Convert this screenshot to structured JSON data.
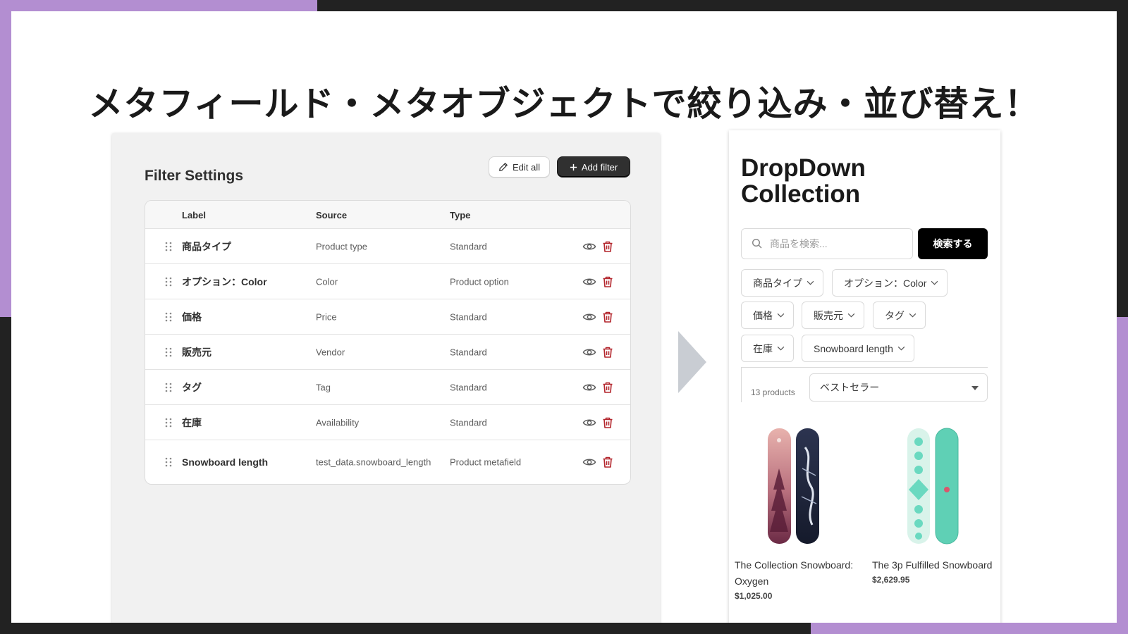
{
  "headline": "メタフィールド・メタオブジェクトで絞り込み・並び替え！",
  "colors": {
    "accent_purple": "#b38ed1",
    "background_dark": "#222222",
    "trash_red": "#b3262d"
  },
  "admin": {
    "title": "Filter Settings",
    "edit_all_label": "Edit all",
    "add_filter_label": "Add filter",
    "columns": {
      "label": "Label",
      "source": "Source",
      "type": "Type"
    },
    "rows": [
      {
        "label": "商品タイプ",
        "source": "Product type",
        "type": "Standard"
      },
      {
        "label": "オプション：Color",
        "source": "Color",
        "type": "Product option"
      },
      {
        "label": "価格",
        "source": "Price",
        "type": "Standard"
      },
      {
        "label": "販売元",
        "source": "Vendor",
        "type": "Standard"
      },
      {
        "label": "タグ",
        "source": "Tag",
        "type": "Standard"
      },
      {
        "label": "在庫",
        "source": "Availability",
        "type": "Standard"
      },
      {
        "label": "Snowboard length",
        "source": "test_data.snowboard_length",
        "type": "Product metafield"
      }
    ]
  },
  "store": {
    "title": "DropDown Collection",
    "search_placeholder": "商品を検索...",
    "search_button": "検索する",
    "chips": [
      "商品タイプ",
      "オプション：Color",
      "価格",
      "販売元",
      "タグ",
      "在庫",
      "Snowboard length"
    ],
    "product_count": "13 products",
    "sort_selected": "ベストセラー",
    "products": [
      {
        "name": "The Collection Snowboard: Oxygen",
        "price": "$1,025.00"
      },
      {
        "name": "The 3p Fulfilled Snowboard",
        "price": "$2,629.95"
      }
    ]
  }
}
